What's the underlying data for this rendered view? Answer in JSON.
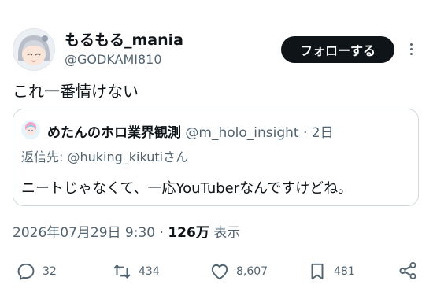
{
  "author": {
    "display_name": "もるもる_mania",
    "handle": "@GODKAMI810"
  },
  "follow_label": "フォローする",
  "tweet_text": "これ一番情けない",
  "quoted": {
    "display_name": "めたんのホロ業界観測",
    "handle": "@m_holo_insight",
    "separator": "·",
    "age": "2日",
    "reply_prefix": "返信先: ",
    "reply_to": "@huking_kikuti",
    "reply_suffix": "さん",
    "text": "ニートじゃなくて、一応YouTuberなんですけどね。"
  },
  "meta": {
    "timestamp": "2026年07月29日 9:30",
    "separator": "·",
    "views_count": "126万",
    "views_label": "表示"
  },
  "actions": {
    "replies": "32",
    "retweets": "434",
    "likes": "8,607",
    "bookmarks": "481"
  }
}
